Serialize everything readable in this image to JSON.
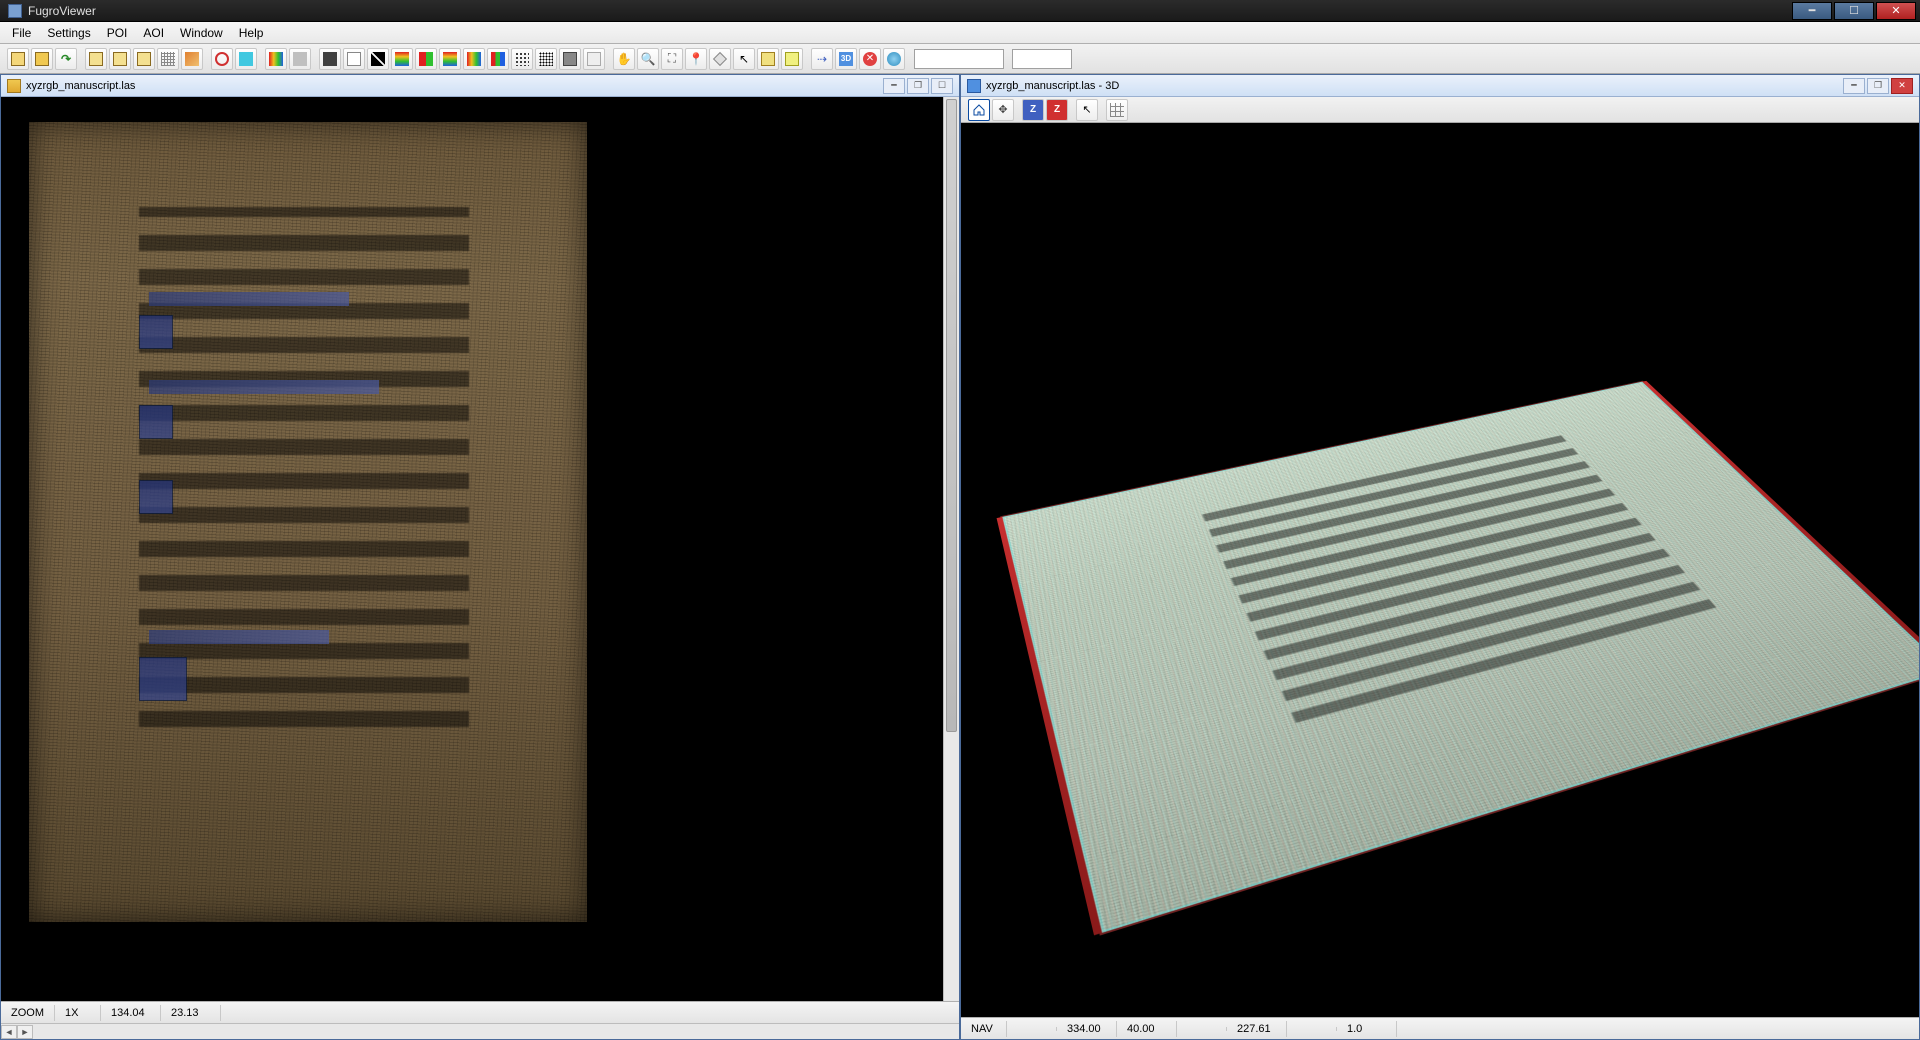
{
  "app": {
    "title": "FugroViewer"
  },
  "menu": {
    "file": "File",
    "settings": "Settings",
    "poi": "POI",
    "aoi": "AOI",
    "window": "Window",
    "help": "Help"
  },
  "toolbar_icons": {
    "open": "open-file-icon",
    "open2": "open-folder-icon",
    "redo": "redo-icon",
    "save": "save-icon",
    "saveas": "save-as-icon",
    "export": "export-icon",
    "grid": "grid-icon",
    "layers": "layers-icon",
    "target": "target-icon",
    "cyan": "clip-icon",
    "rainbow": "color-ramp-icon",
    "grey": "grey-ramp-icon",
    "dark": "dark-ramp-icon",
    "bw": "bw-icon",
    "diag": "contrast-icon",
    "rainbow_v": "elevation-ramp-icon",
    "rg": "rg-ramp-icon",
    "rgb": "rgb-ramp-icon",
    "rgb_bars": "rgb-bars-icon",
    "dots": "point-cloud-icon",
    "dots2": "dense-points-icon",
    "sq": "tile-icon",
    "extra": "options-icon",
    "hand": "pan-icon",
    "zin": "zoom-in-icon",
    "zbox": "zoom-box-icon",
    "pin": "pin-icon",
    "diamond": "marker-icon",
    "pick": "pick-icon",
    "ruler": "ruler-icon",
    "tape": "measure-icon",
    "link": "link-icon",
    "threeD_label": "3D",
    "cancel": "cancel-icon",
    "globe": "globe-icon"
  },
  "left_pane": {
    "title": "xyzrgb_manuscript.las",
    "status": {
      "mode": "ZOOM",
      "zoom": "1X",
      "x": "134.04",
      "y": "23.13"
    }
  },
  "right_pane": {
    "title": "xyzrgb_manuscript.las - 3D",
    "toolbar": {
      "home": "home-icon",
      "pick": "pick-3d-icon",
      "z_down": "Z",
      "z_up": "Z",
      "sel": "select-3d-icon",
      "grid": "grid-3d-icon"
    },
    "status": {
      "mode": "NAV",
      "v1": "334.00",
      "v2": "40.00",
      "v3": "227.61",
      "v4": "1.0"
    }
  }
}
